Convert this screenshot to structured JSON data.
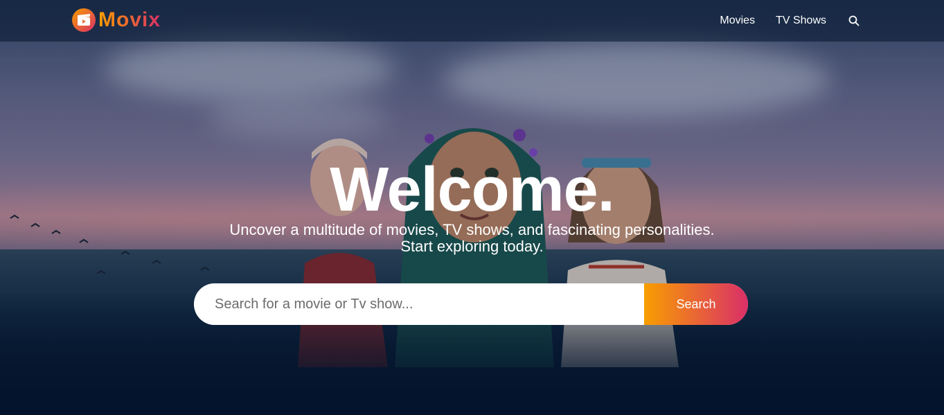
{
  "header": {
    "logo_text": "Movix",
    "nav": [
      {
        "label": "Movies"
      },
      {
        "label": "TV Shows"
      }
    ],
    "search_icon": "search-icon"
  },
  "hero": {
    "title": "Welcome.",
    "subtitle_line1": "Uncover a multitude of movies, TV shows, and fascinating personalities.",
    "subtitle_line2": "Start exploring today."
  },
  "search": {
    "placeholder": "Search for a movie or Tv show...",
    "button_label": "Search"
  },
  "colors": {
    "accent_start": "#f89e00",
    "accent_end": "#da2f68",
    "background": "#04152d"
  }
}
